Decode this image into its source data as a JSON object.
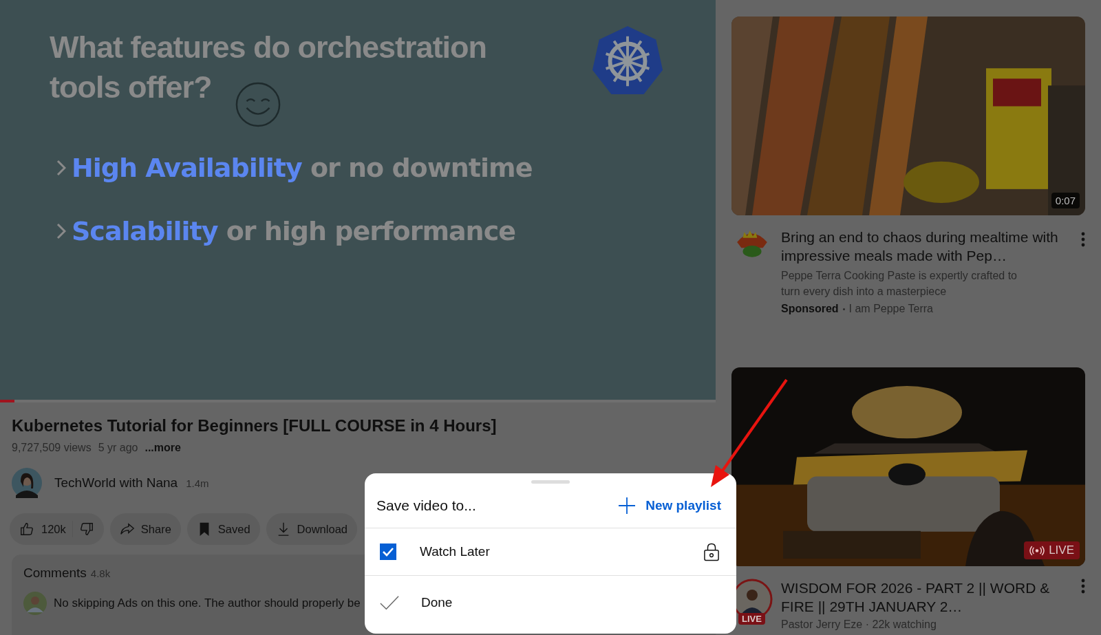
{
  "video": {
    "slide": {
      "title_lines": [
        "What features do orchestration",
        "tools offer?"
      ],
      "bullets": [
        "**High Availability** or no downtime",
        "**Scalability** or high performance"
      ]
    },
    "progress": {
      "level": 0.02
    }
  },
  "title": "Kubernetes Tutorial for Beginners [FULL COURSE in 4 Hours]",
  "meta": {
    "views": "9,727,509 views",
    "age": "5 yr ago",
    "more": "...more"
  },
  "channel": {
    "name": "TechWorld with Nana",
    "subscribers": "1.4m"
  },
  "actions": [
    {
      "kind": "like",
      "label": "120k"
    },
    {
      "kind": "share",
      "label": "Share"
    },
    {
      "kind": "saved",
      "label": "Saved"
    },
    {
      "kind": "download",
      "label": "Download"
    }
  ],
  "comments": {
    "title": "Comments",
    "count": "4.8k",
    "first": "No skipping Ads on this one. The author should properly be"
  },
  "recommendations": [
    {
      "kind": "ad",
      "duration": "0:07",
      "title": "Bring an end to chaos during mealtime with impressive meals made with Pep…",
      "description": "Peppe Terra Cooking Paste is expertly crafted to turn every dish into a masterpiece",
      "sponsored": "Sponsored",
      "advertiser": "I am Peppe Terra"
    },
    {
      "kind": "live",
      "badge": "LIVE",
      "avatar_badge": "LIVE",
      "title": "WISDOM FOR 2026 - PART 2 || WORD & FIRE || 29TH JANUARY 2…",
      "byline": "Pastor Jerry Eze · 22k watching"
    }
  ],
  "dialog": {
    "title": "Save video to...",
    "new_playlist": "New playlist",
    "playlists": [
      {
        "name": "Watch Later",
        "checked": true,
        "private": true
      }
    ],
    "done": "Done"
  }
}
